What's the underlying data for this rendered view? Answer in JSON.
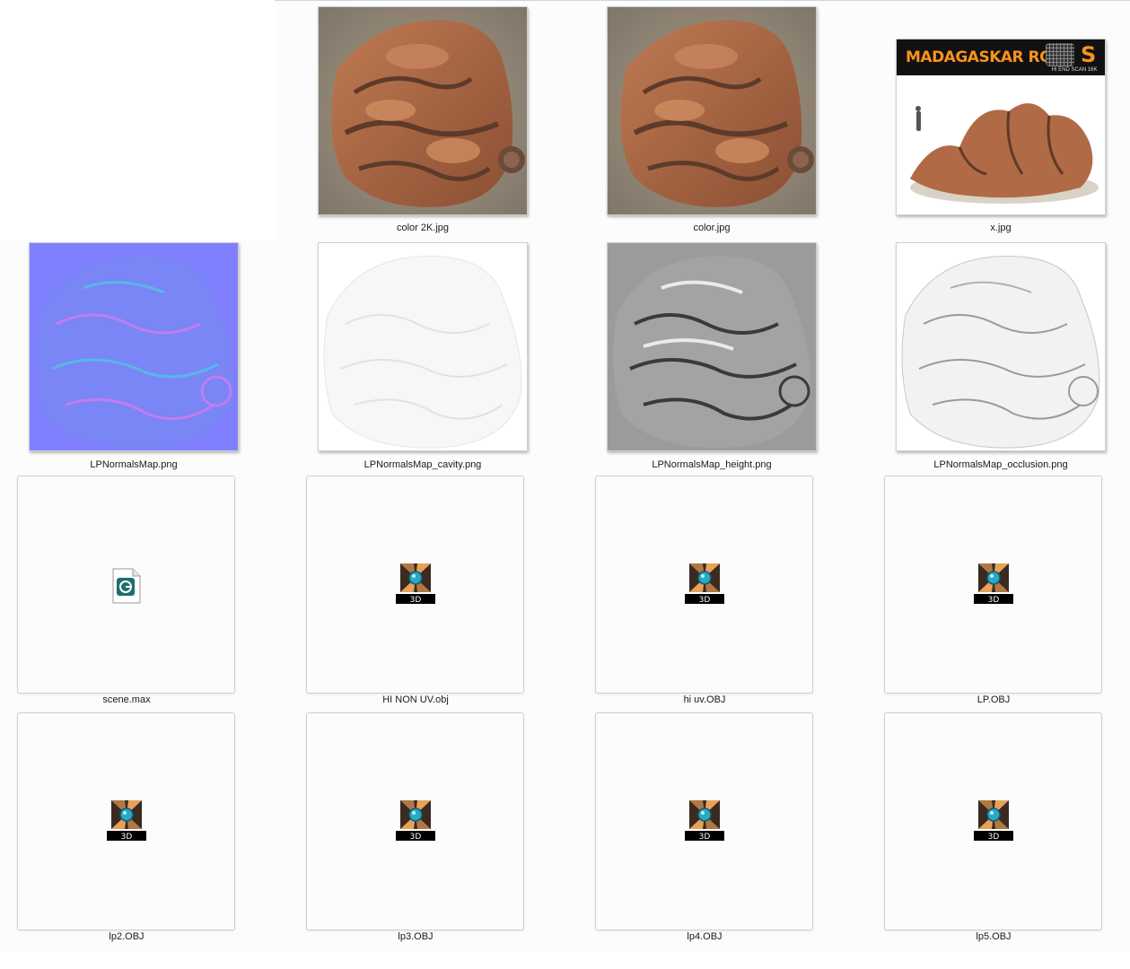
{
  "files": [
    {
      "name": "color 2K.jpg",
      "kind": "rock-color-image"
    },
    {
      "name": "color.jpg",
      "kind": "rock-color-image"
    },
    {
      "name": "x.jpg",
      "kind": "preview-image",
      "banner_title": "MADAGASKAR ROCK",
      "banner_badge": "S",
      "banner_tag": "HI END SCAN 16K"
    },
    {
      "name": "LPNormalsMap.png",
      "kind": "normal-map-image"
    },
    {
      "name": "LPNormalsMap_cavity.png",
      "kind": "cavity-map-image"
    },
    {
      "name": "LPNormalsMap_height.png",
      "kind": "height-map-image"
    },
    {
      "name": "LPNormalsMap_occlusion.png",
      "kind": "occlusion-map-image"
    },
    {
      "name": "scene.max",
      "kind": "max-file-icon"
    },
    {
      "name": "HI NON UV.obj",
      "kind": "obj-3d-icon",
      "badge": "3D"
    },
    {
      "name": "hi uv.OBJ",
      "kind": "obj-3d-icon",
      "badge": "3D"
    },
    {
      "name": "LP.OBJ",
      "kind": "obj-3d-icon",
      "badge": "3D"
    },
    {
      "name": "lp2.OBJ",
      "kind": "obj-3d-icon",
      "badge": "3D"
    },
    {
      "name": "lp3.OBJ",
      "kind": "obj-3d-icon",
      "badge": "3D"
    },
    {
      "name": "lp4.OBJ",
      "kind": "obj-3d-icon",
      "badge": "3D"
    },
    {
      "name": "lp5.OBJ",
      "kind": "obj-3d-icon",
      "badge": "3D"
    }
  ],
  "colors": {
    "rock": "#b06a45",
    "rock_dark": "#5e3a29",
    "sand": "#9c8f7a",
    "normal_bg": "#8080ff",
    "height_bg": "#9b9b9b",
    "banner_orange": "#f7931e"
  }
}
